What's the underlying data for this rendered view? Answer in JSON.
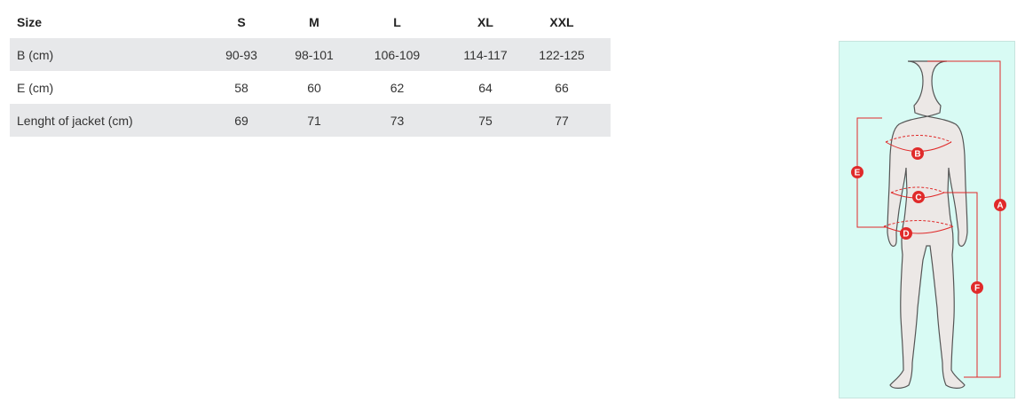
{
  "table": {
    "headers": [
      "Size",
      "S",
      "M",
      "L",
      "XL",
      "XXL"
    ],
    "rows": [
      [
        "B (cm)",
        "90-93",
        "98-101",
        "106-109",
        "114-117",
        "122-125"
      ],
      [
        "E (cm)",
        "58",
        "60",
        "62",
        "64",
        "66"
      ],
      [
        "Lenght of jacket (cm)",
        "69",
        "71",
        "73",
        "75",
        "77"
      ]
    ]
  },
  "figure": {
    "markers": [
      "A",
      "B",
      "C",
      "D",
      "E",
      "F"
    ],
    "colors": {
      "panel_background": "#d8fbf4",
      "body_fill": "#ece8e6",
      "body_outline": "#555555",
      "measure_line": "#e02a2a",
      "row_shade": "#e7e8ea"
    }
  }
}
